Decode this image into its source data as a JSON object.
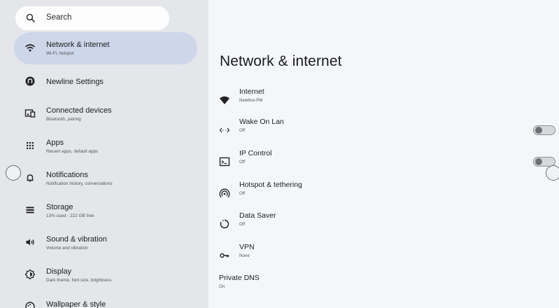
{
  "search": {
    "placeholder": "Search",
    "icon": "search-icon"
  },
  "sidebar": {
    "items": [
      {
        "title": "Network & internet",
        "subtitle": "Wi-Fi, hotspot",
        "icon": "wifi-icon",
        "active": true
      },
      {
        "title": "Newline Settings",
        "subtitle": "",
        "icon": "newline-logo-icon"
      },
      {
        "title": "Connected devices",
        "subtitle": "Bluetooth, pairing",
        "icon": "connected-devices-icon"
      },
      {
        "title": "Apps",
        "subtitle": "Recent apps, default apps",
        "icon": "apps-grid-icon"
      },
      {
        "title": "Notifications",
        "subtitle": "Notification history, conversations",
        "icon": "bell-icon"
      },
      {
        "title": "Storage",
        "subtitle": "13% used - 222 GB free",
        "icon": "storage-icon"
      },
      {
        "title": "Sound & vibration",
        "subtitle": "Volume and vibration",
        "icon": "speaker-icon"
      },
      {
        "title": "Display",
        "subtitle": "Dark theme, font size, brightness",
        "icon": "display-brightness-icon"
      },
      {
        "title": "Wallpaper & style",
        "subtitle": "",
        "icon": "palette-icon"
      }
    ]
  },
  "main": {
    "title": "Network & internet",
    "rows": [
      {
        "title": "Internet",
        "subtitle": "Newline-PM",
        "icon": "wifi-filled-icon"
      },
      {
        "title": "Wake On Lan",
        "subtitle": "Off",
        "icon": "arrows-exchange-icon",
        "toggle": false
      },
      {
        "title": "IP Control",
        "subtitle": "Off",
        "icon": "terminal-icon",
        "toggle": false
      },
      {
        "title": "Hotspot & tethering",
        "subtitle": "Off",
        "icon": "hotspot-icon"
      },
      {
        "title": "Data Saver",
        "subtitle": "Off",
        "icon": "data-saver-icon"
      },
      {
        "title": "VPN",
        "subtitle": "None",
        "icon": "vpn-key-icon"
      },
      {
        "title": "Private DNS",
        "subtitle": "On",
        "icon": ""
      }
    ]
  },
  "colors": {
    "sidebar_bg": "#e4e6ea",
    "active_item_bg": "#ced6ea",
    "main_bg": "#f4f6f9"
  }
}
